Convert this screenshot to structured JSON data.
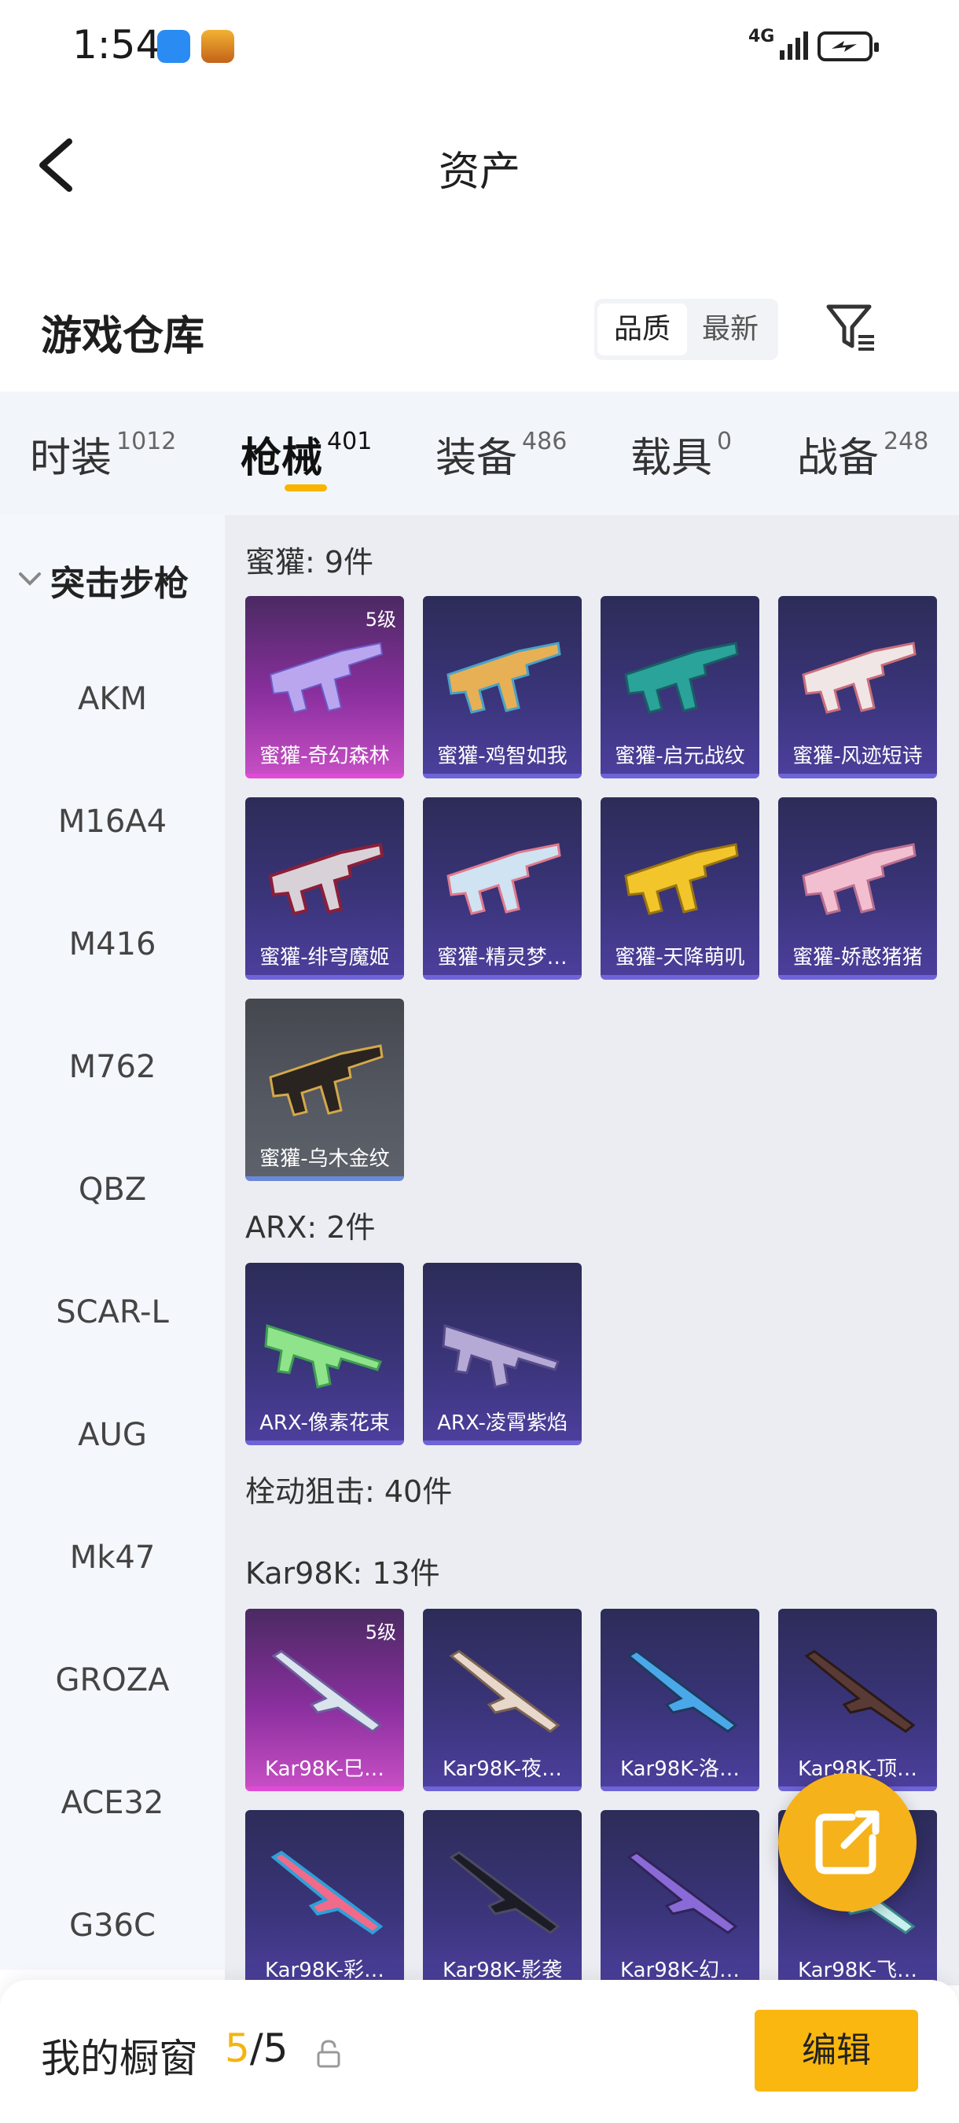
{
  "status_bar": {
    "time": "1:54",
    "network": "4G"
  },
  "header": {
    "title": "资产"
  },
  "warehouse": {
    "title": "游戏仓库",
    "sort_options": [
      "品质",
      "最新"
    ]
  },
  "tabs": [
    {
      "label": "时装",
      "count": "1012"
    },
    {
      "label": "枪械",
      "count": "401",
      "active": true
    },
    {
      "label": "装备",
      "count": "486"
    },
    {
      "label": "载具",
      "count": "0"
    },
    {
      "label": "战备",
      "count": "248"
    }
  ],
  "sidebar": {
    "category": "突击步枪",
    "items": [
      "AKM",
      "M16A4",
      "M416",
      "M762",
      "QBZ",
      "SCAR-L",
      "AUG",
      "Mk47",
      "GROZA",
      "ACE32",
      "G36C"
    ]
  },
  "groups": [
    {
      "title": "蜜獾: 9件"
    },
    {
      "title": "ARX: 2件"
    },
    {
      "title": "栓动狙击: 40件"
    },
    {
      "title": "Kar98K: 13件"
    }
  ],
  "cards": [
    {
      "name": "蜜獾-奇幻森林",
      "level": "5级",
      "rarity": "legendary"
    },
    {
      "name": "蜜獾-鸡智如我",
      "rarity": "epic"
    },
    {
      "name": "蜜獾-启元战纹",
      "rarity": "epic"
    },
    {
      "name": "蜜獾-风迹短诗",
      "rarity": "epic"
    },
    {
      "name": "蜜獾-绯穹魔姬",
      "rarity": "epic"
    },
    {
      "name": "蜜獾-精灵梦…",
      "rarity": "epic"
    },
    {
      "name": "蜜獾-天降萌叽",
      "rarity": "epic"
    },
    {
      "name": "蜜獾-娇憨猪猪",
      "rarity": "epic"
    },
    {
      "name": "蜜獾-乌木金纹",
      "rarity": "rare"
    },
    {
      "name": "ARX-像素花束",
      "rarity": "epic"
    },
    {
      "name": "ARX-凌霄紫焰",
      "rarity": "epic"
    },
    {
      "name": "Kar98K-巳…",
      "level": "5级",
      "rarity": "legendary"
    },
    {
      "name": "Kar98K-夜…",
      "rarity": "epic"
    },
    {
      "name": "Kar98K-洛…",
      "rarity": "epic"
    },
    {
      "name": "Kar98K-顶…",
      "rarity": "epic"
    },
    {
      "name": "Kar98K-彩…",
      "rarity": "epic"
    },
    {
      "name": "Kar98K-影袭",
      "rarity": "epic"
    },
    {
      "name": "Kar98K-幻…",
      "rarity": "epic"
    },
    {
      "name": "Kar98K-飞…",
      "rarity": "epic"
    }
  ],
  "showcase": {
    "label": "我的橱窗",
    "current": "5",
    "separator": "/",
    "total": "5",
    "edit_label": "编辑"
  },
  "colors": {
    "accent": "#f8b400",
    "legendary": "#c64ec4",
    "epic": "#4b3f9c",
    "rare": "#555962"
  }
}
